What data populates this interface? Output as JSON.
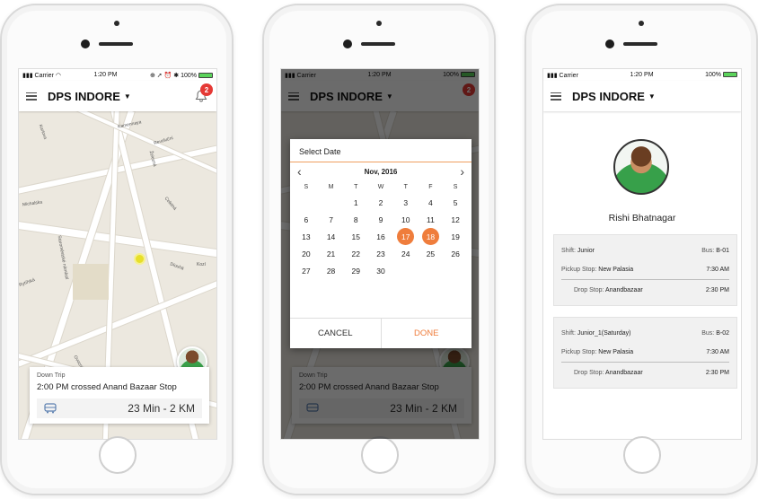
{
  "status_bar": {
    "carrier": "Carrier",
    "time": "1:20 PM",
    "battery": "100%"
  },
  "app": {
    "title": "DPS INDORE",
    "notifications": "2"
  },
  "tracking": {
    "trip_type": "Down Trip",
    "message": "2:00 PM crossed Anand Bazaar Stop",
    "eta": "23 Min - 2 KM"
  },
  "map_labels": [
    "Kamennaya",
    "Karlova",
    "Michalska",
    "Rytířská",
    "Staroměstské náměstí",
    "Železná",
    "Celetná",
    "Ovocný trh",
    "Dlouhá",
    "Revoluční",
    "Kozí"
  ],
  "date_picker": {
    "title": "Select Date",
    "month": "Nov, 2016",
    "weekdays": [
      "S",
      "M",
      "T",
      "W",
      "T",
      "F",
      "S"
    ],
    "days": [
      "1",
      "2",
      "3",
      "4",
      "5",
      "6",
      "7",
      "8",
      "9",
      "10",
      "11",
      "12",
      "13",
      "14",
      "15",
      "16",
      "17",
      "18",
      "19",
      "20",
      "21",
      "22",
      "23",
      "24",
      "25",
      "26",
      "27",
      "28",
      "29",
      "30"
    ],
    "selected": [
      "17",
      "18"
    ],
    "cancel": "CANCEL",
    "done": "DONE"
  },
  "profile": {
    "name": "Rishi Bhatnagar",
    "trips": [
      {
        "shift_label": "Shift:",
        "shift": "Junior",
        "bus_label": "Bus:",
        "bus": "B-01",
        "pickup_label": "Pickup Stop:",
        "pickup": "New Palasia",
        "pickup_time": "7:30 AM",
        "drop_label": "Drop Stop:",
        "drop": "Anandbazaar",
        "drop_time": "2:30 PM"
      },
      {
        "shift_label": "Shift:",
        "shift": "Junior_1(Saturday)",
        "bus_label": "Bus:",
        "bus": "B-02",
        "pickup_label": "Pickup Stop:",
        "pickup": "New Palasia",
        "pickup_time": "7:30 AM",
        "drop_label": "Drop Stop:",
        "drop": "Anandbazaar",
        "drop_time": "2:30 PM"
      }
    ]
  },
  "colors": {
    "accent": "#ef7d3c",
    "badge": "#e53935",
    "pin": "#e7df2a"
  }
}
